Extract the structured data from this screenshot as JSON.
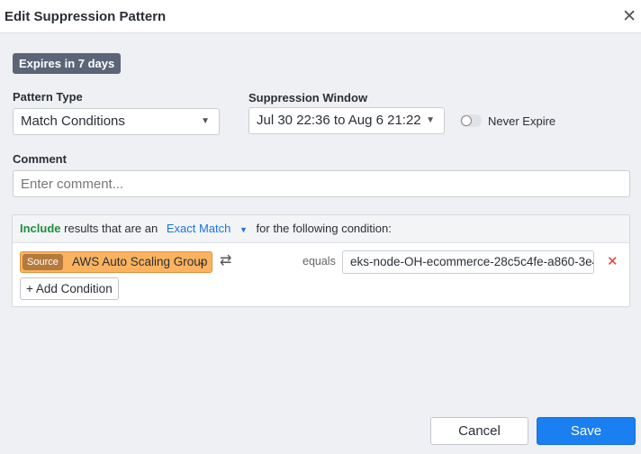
{
  "dialog": {
    "title": "Edit Suppression Pattern"
  },
  "badge": "Expires in 7 days",
  "pattern_type": {
    "label": "Pattern Type",
    "value": "Match Conditions"
  },
  "suppression_window": {
    "label": "Suppression Window",
    "value": "Jul 30 22:36 to Aug 6 21:22"
  },
  "never_expire": {
    "label": "Never Expire",
    "on": false
  },
  "comment": {
    "label": "Comment",
    "placeholder": "Enter comment...",
    "value": ""
  },
  "condition_panel": {
    "include": "Include",
    "text1": "results that are an",
    "match_type": "Exact Match",
    "text2": "for the following condition:",
    "condition": {
      "tag": "Source",
      "field": "AWS Auto Scaling Group",
      "operator": "equals",
      "value": "eks-node-OH-ecommerce-28c5c4fe-a860-3e4"
    },
    "add_condition": "+ Add Condition"
  },
  "buttons": {
    "cancel": "Cancel",
    "save": "Save"
  },
  "colors": {
    "primary": "#1a7ff0",
    "include": "#1e8e3e",
    "source_chip": "#fbb35f",
    "remove": "#e53935"
  }
}
